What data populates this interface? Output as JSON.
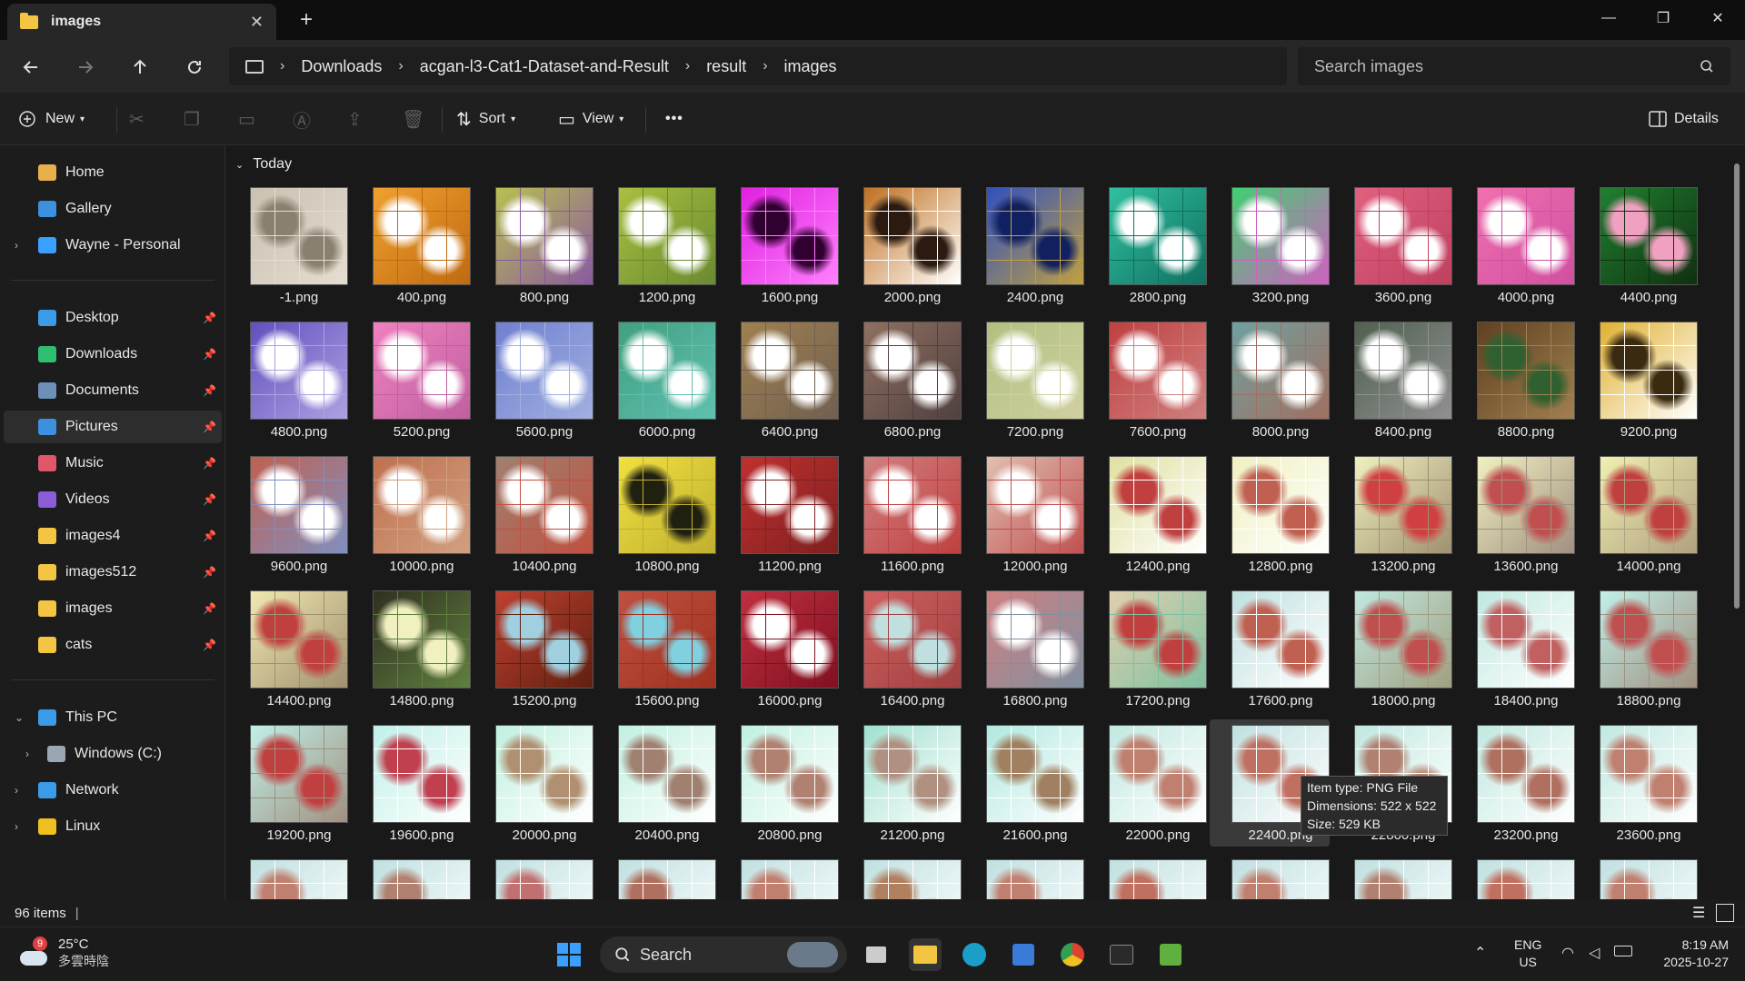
{
  "window": {
    "tab_title": "images",
    "minimize": "—",
    "restore": "❐",
    "close": "✕"
  },
  "navbar": {
    "breadcrumb": [
      "Downloads",
      "acgan-l3-Cat1-Dataset-and-Result",
      "result",
      "images"
    ],
    "search_placeholder": "Search images"
  },
  "commands": {
    "new": "New",
    "sort": "Sort",
    "view": "View",
    "more": "•••",
    "details": "Details"
  },
  "sidebar": {
    "quick": [
      {
        "label": "Home",
        "icon": "home-icon",
        "color": "#e8b04a"
      },
      {
        "label": "Gallery",
        "icon": "gallery-icon",
        "color": "#3d8fe0"
      },
      {
        "label": "Wayne - Personal",
        "icon": "onedrive-icon",
        "color": "#3aa0ff"
      }
    ],
    "pinned": [
      {
        "label": "Desktop",
        "icon": "desktop-icon",
        "color": "#3a9be8",
        "selected": false
      },
      {
        "label": "Downloads",
        "icon": "downloads-icon",
        "color": "#2fbf71",
        "selected": false
      },
      {
        "label": "Documents",
        "icon": "documents-icon",
        "color": "#6d8fb8",
        "selected": false
      },
      {
        "label": "Pictures",
        "icon": "pictures-icon",
        "color": "#3d8fe0",
        "selected": true
      },
      {
        "label": "Music",
        "icon": "music-icon",
        "color": "#e0566a",
        "selected": false
      },
      {
        "label": "Videos",
        "icon": "videos-icon",
        "color": "#8a5cd6",
        "selected": false
      },
      {
        "label": "images4",
        "icon": "folder-icon",
        "color": "#f4c542",
        "selected": false
      },
      {
        "label": "images512",
        "icon": "folder-icon",
        "color": "#f4c542",
        "selected": false
      },
      {
        "label": "images",
        "icon": "folder-icon",
        "color": "#f4c542",
        "selected": false
      },
      {
        "label": "cats",
        "icon": "folder-icon",
        "color": "#f4c542",
        "selected": false
      }
    ],
    "tree": [
      {
        "label": "This PC",
        "icon": "pc-icon",
        "color": "#3a9be8"
      },
      {
        "label": "Windows (C:)",
        "icon": "drive-icon",
        "color": "#9aa6b2"
      },
      {
        "label": "Network",
        "icon": "network-icon",
        "color": "#3a9be8"
      },
      {
        "label": "Linux",
        "icon": "linux-icon",
        "color": "#f0c020"
      }
    ]
  },
  "content": {
    "group_label": "Today",
    "files": [
      {
        "name": "-1.png",
        "c1": "#c9c2b3",
        "c2": "#8a8070",
        "c3": "#e4ddd0"
      },
      {
        "name": "400.png",
        "c1": "#f0a030",
        "c2": "#ffffff",
        "c3": "#c06a10"
      },
      {
        "name": "800.png",
        "c1": "#b8c050",
        "c2": "#ffffff",
        "c3": "#8a5aa0"
      },
      {
        "name": "1200.png",
        "c1": "#a8c040",
        "c2": "#ffffff",
        "c3": "#6a8a30"
      },
      {
        "name": "1600.png",
        "c1": "#e020e0",
        "c2": "#300030",
        "c3": "#ff80ff"
      },
      {
        "name": "2000.png",
        "c1": "#c07020",
        "c2": "#2a1a10",
        "c3": "#ffffff"
      },
      {
        "name": "2400.png",
        "c1": "#3050c0",
        "c2": "#102060",
        "c3": "#c0a040"
      },
      {
        "name": "2800.png",
        "c1": "#30c0a0",
        "c2": "#ffffff",
        "c3": "#107060"
      },
      {
        "name": "3200.png",
        "c1": "#40d070",
        "c2": "#ffffff",
        "c3": "#d060c0"
      },
      {
        "name": "3600.png",
        "c1": "#e06080",
        "c2": "#ffffff",
        "c3": "#c04060"
      },
      {
        "name": "4000.png",
        "c1": "#f070b0",
        "c2": "#ffffff",
        "c3": "#d050a0"
      },
      {
        "name": "4400.png",
        "c1": "#208030",
        "c2": "#f0a0c0",
        "c3": "#103010"
      },
      {
        "name": "4800.png",
        "c1": "#6050c0",
        "c2": "#ffffff",
        "c3": "#b0a0e0"
      },
      {
        "name": "5200.png",
        "c1": "#f080c0",
        "c2": "#ffffff",
        "c3": "#c060a0"
      },
      {
        "name": "5600.png",
        "c1": "#7080d0",
        "c2": "#ffffff",
        "c3": "#a0b0e0"
      },
      {
        "name": "6000.png",
        "c1": "#40a080",
        "c2": "#ffffff",
        "c3": "#60c0b0"
      },
      {
        "name": "6400.png",
        "c1": "#a08050",
        "c2": "#ffffff",
        "c3": "#706050"
      },
      {
        "name": "6800.png",
        "c1": "#907060",
        "c2": "#ffffff",
        "c3": "#504040"
      },
      {
        "name": "7200.png",
        "c1": "#b0c080",
        "c2": "#ffffff",
        "c3": "#d0d0a0"
      },
      {
        "name": "7600.png",
        "c1": "#c04040",
        "c2": "#ffffff",
        "c3": "#d08080"
      },
      {
        "name": "8000.png",
        "c1": "#70a0a0",
        "c2": "#ffffff",
        "c3": "#a07060"
      },
      {
        "name": "8400.png",
        "c1": "#506050",
        "c2": "#ffffff",
        "c3": "#909090"
      },
      {
        "name": "8800.png",
        "c1": "#604020",
        "c2": "#306030",
        "c3": "#a08050"
      },
      {
        "name": "9200.png",
        "c1": "#e0b030",
        "c2": "#3a2a10",
        "c3": "#ffffff"
      },
      {
        "name": "9600.png",
        "c1": "#c06050",
        "c2": "#ffffff",
        "c3": "#8090c0"
      },
      {
        "name": "10000.png",
        "c1": "#c07050",
        "c2": "#ffffff",
        "c3": "#d0a080"
      },
      {
        "name": "10400.png",
        "c1": "#a08070",
        "c2": "#ffffff",
        "c3": "#c05040"
      },
      {
        "name": "10800.png",
        "c1": "#f0e040",
        "c2": "#202010",
        "c3": "#c0b030"
      },
      {
        "name": "11200.png",
        "c1": "#c03030",
        "c2": "#ffffff",
        "c3": "#802020"
      },
      {
        "name": "11600.png",
        "c1": "#d08080",
        "c2": "#ffffff",
        "c3": "#c04040"
      },
      {
        "name": "12000.png",
        "c1": "#e0c0b0",
        "c2": "#ffffff",
        "c3": "#c05050"
      },
      {
        "name": "12400.png",
        "c1": "#e0e0a0",
        "c2": "#c04040",
        "c3": "#ffffff"
      },
      {
        "name": "12800.png",
        "c1": "#f0f0c0",
        "c2": "#c06050",
        "c3": "#ffffff"
      },
      {
        "name": "13200.png",
        "c1": "#f0f0c0",
        "c2": "#d04040",
        "c3": "#a09070"
      },
      {
        "name": "13600.png",
        "c1": "#f0f0c0",
        "c2": "#c05050",
        "c3": "#a09080"
      },
      {
        "name": "14000.png",
        "c1": "#f0f0b0",
        "c2": "#c04040",
        "c3": "#b0a080"
      },
      {
        "name": "14400.png",
        "c1": "#f0e8b0",
        "c2": "#c04040",
        "c3": "#a09070"
      },
      {
        "name": "14800.png",
        "c1": "#303020",
        "c2": "#f0f0c0",
        "c3": "#608040"
      },
      {
        "name": "15200.png",
        "c1": "#c04030",
        "c2": "#a0d0e0",
        "c3": "#602010"
      },
      {
        "name": "15600.png",
        "c1": "#c05040",
        "c2": "#80d0e0",
        "c3": "#a03020"
      },
      {
        "name": "16000.png",
        "c1": "#c03040",
        "c2": "#ffffff",
        "c3": "#801020"
      },
      {
        "name": "16400.png",
        "c1": "#d06060",
        "c2": "#c0e0e0",
        "c3": "#a04040"
      },
      {
        "name": "16800.png",
        "c1": "#d08080",
        "c2": "#ffffff",
        "c3": "#8090a0"
      },
      {
        "name": "17200.png",
        "c1": "#e0d0b0",
        "c2": "#c04040",
        "c3": "#80c0a0"
      },
      {
        "name": "17600.png",
        "c1": "#c0e0e0",
        "c2": "#c06050",
        "c3": "#ffffff"
      },
      {
        "name": "18000.png",
        "c1": "#c0e8e0",
        "c2": "#c05050",
        "c3": "#a0a080"
      },
      {
        "name": "18400.png",
        "c1": "#c0e8e0",
        "c2": "#c06060",
        "c3": "#ffffff"
      },
      {
        "name": "18800.png",
        "c1": "#c0f0e8",
        "c2": "#c05050",
        "c3": "#a09080"
      },
      {
        "name": "19200.png",
        "c1": "#c0f0e8",
        "c2": "#c04040",
        "c3": "#a09080"
      },
      {
        "name": "19600.png",
        "c1": "#c0f0e8",
        "c2": "#c04050",
        "c3": "#ffffff"
      },
      {
        "name": "20000.png",
        "c1": "#c0f0e0",
        "c2": "#b09070",
        "c3": "#ffffff"
      },
      {
        "name": "20400.png",
        "c1": "#c0f0e0",
        "c2": "#a08070",
        "c3": "#ffffff"
      },
      {
        "name": "20800.png",
        "c1": "#c0f0e0",
        "c2": "#b08070",
        "c3": "#ffffff"
      },
      {
        "name": "21200.png",
        "c1": "#a0e0d0",
        "c2": "#b09080",
        "c3": "#ffffff"
      },
      {
        "name": "21600.png",
        "c1": "#b0e8e0",
        "c2": "#a08060",
        "c3": "#ffffff"
      },
      {
        "name": "22000.png",
        "c1": "#c0e8e0",
        "c2": "#c08070",
        "c3": "#ffffff"
      },
      {
        "name": "22400.png",
        "c1": "#c0e0e0",
        "c2": "#c07060",
        "c3": "#ffffff",
        "hover": true
      },
      {
        "name": "22800.png",
        "c1": "#c0e8e0",
        "c2": "#b08070",
        "c3": "#ffffff"
      },
      {
        "name": "23200.png",
        "c1": "#c0e8e0",
        "c2": "#b07060",
        "c3": "#ffffff"
      },
      {
        "name": "23600.png",
        "c1": "#c0e8e0",
        "c2": "#c08070",
        "c3": "#ffffff"
      },
      {
        "name": "",
        "c1": "#c0e0e0",
        "c2": "#c08070",
        "c3": "#ffffff"
      },
      {
        "name": "",
        "c1": "#c0e0e0",
        "c2": "#b08070",
        "c3": "#ffffff"
      },
      {
        "name": "",
        "c1": "#c0e0e0",
        "c2": "#c07070",
        "c3": "#ffffff"
      },
      {
        "name": "",
        "c1": "#c0e0e0",
        "c2": "#b07060",
        "c3": "#ffffff"
      },
      {
        "name": "",
        "c1": "#c0e0e0",
        "c2": "#c08070",
        "c3": "#ffffff"
      },
      {
        "name": "",
        "c1": "#c0e0e0",
        "c2": "#b08060",
        "c3": "#ffffff"
      },
      {
        "name": "",
        "c1": "#c0e0e0",
        "c2": "#c08070",
        "c3": "#ffffff"
      },
      {
        "name": "",
        "c1": "#c0e0e0",
        "c2": "#c07060",
        "c3": "#ffffff"
      },
      {
        "name": "",
        "c1": "#c0e0e0",
        "c2": "#c08070",
        "c3": "#ffffff"
      },
      {
        "name": "",
        "c1": "#c0e0e0",
        "c2": "#b08070",
        "c3": "#ffffff"
      },
      {
        "name": "",
        "c1": "#c0e0e0",
        "c2": "#c07060",
        "c3": "#ffffff"
      },
      {
        "name": "",
        "c1": "#c0e0e0",
        "c2": "#c08070",
        "c3": "#ffffff"
      }
    ],
    "tooltip": {
      "type": "Item type: PNG File",
      "dimensions": "Dimensions: 522 x 522",
      "size": "Size: 529 KB"
    }
  },
  "status": {
    "item_count": "96 items"
  },
  "taskbar": {
    "weather_badge": "9",
    "temperature": "25°C",
    "condition": "多雲時陰",
    "search_label": "Search",
    "lang_top": "ENG",
    "lang_bottom": "US",
    "time": "8:19 AM",
    "date": "2025-10-27"
  }
}
